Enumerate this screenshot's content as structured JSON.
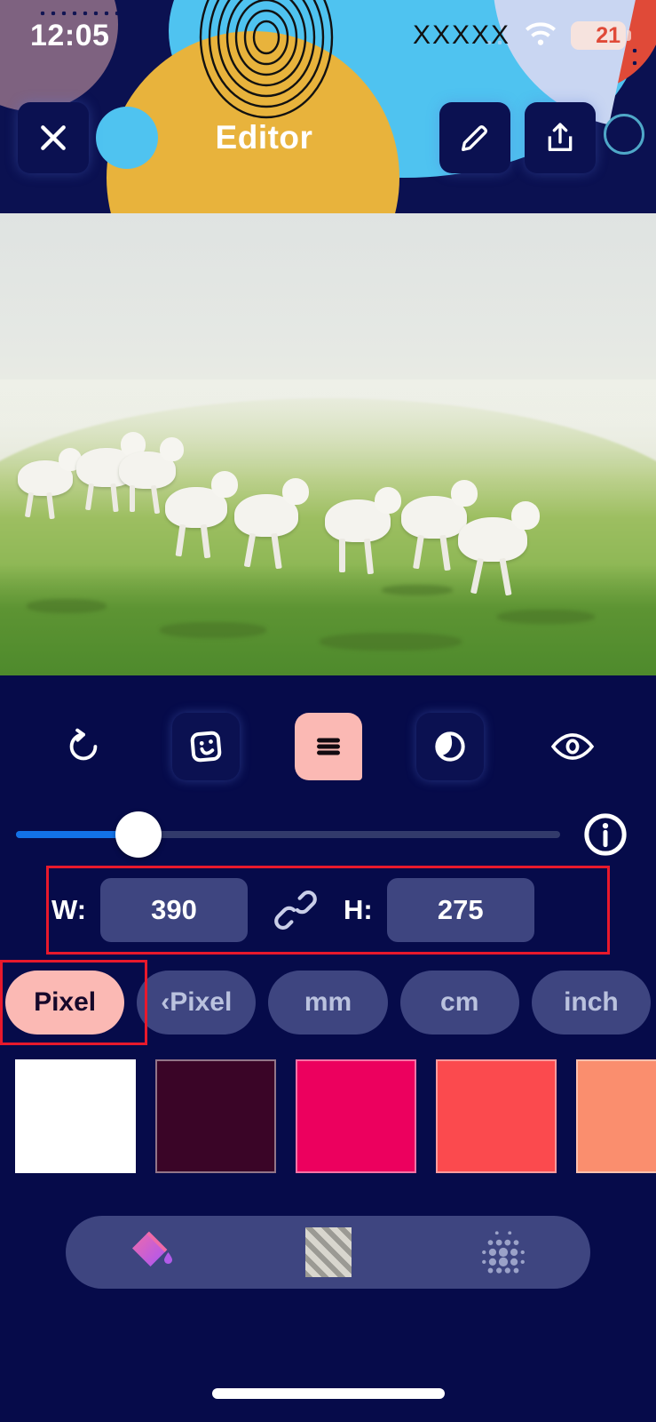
{
  "status_bar": {
    "time": "12:05",
    "carrier": "XXXXX",
    "wifi_icon": "wifi-icon",
    "battery_level": "21"
  },
  "header": {
    "title": "Editor",
    "close_icon": "close-x-icon",
    "edit_icon": "pencil-edit-icon",
    "share_icon": "share-upload-icon"
  },
  "photo": {
    "description": "lambs running in misty green field"
  },
  "toolbar": {
    "items": [
      {
        "name": "reset-rotate-icon",
        "label": "",
        "active": false,
        "boxed": false
      },
      {
        "name": "sticker-icon",
        "label": "",
        "active": false,
        "boxed": true
      },
      {
        "name": "resize-lines-icon",
        "label": "",
        "active": true,
        "boxed": true
      },
      {
        "name": "opacity-droplet-icon",
        "label": "",
        "active": false,
        "boxed": true
      },
      {
        "name": "preview-eye-icon",
        "label": "",
        "active": false,
        "boxed": false
      }
    ]
  },
  "slider": {
    "value_percent": 21,
    "info_icon": "info-circle-icon"
  },
  "dimensions": {
    "width_label": "W:",
    "width_value": "390",
    "height_label": "H:",
    "height_value": "275",
    "link_icon": "chain-link-icon",
    "annotation_color": "#E8192C"
  },
  "units": {
    "options": [
      {
        "label": "Pixel",
        "active": true
      },
      {
        "label": "‹Pixel",
        "active": false
      },
      {
        "label": "mm",
        "active": false
      },
      {
        "label": "cm",
        "active": false
      },
      {
        "label": "inch",
        "active": false
      }
    ]
  },
  "swatches": {
    "colors": [
      "#FFFFFF",
      "#3A0527",
      "#EC005E",
      "#FB4A4E",
      "#FA8E6E"
    ]
  },
  "fill_bar": {
    "items": [
      {
        "name": "paint-bucket-icon",
        "label": ""
      },
      {
        "name": "hatch-pattern-icon",
        "label": ""
      },
      {
        "name": "dot-gradient-icon",
        "label": ""
      }
    ]
  },
  "theme": {
    "background": "#060B4A",
    "header_bg": "#0B1151",
    "accent_pink": "#FBB9B4",
    "control_bg": "#3E4580",
    "slider_blue": "#1272E8"
  }
}
